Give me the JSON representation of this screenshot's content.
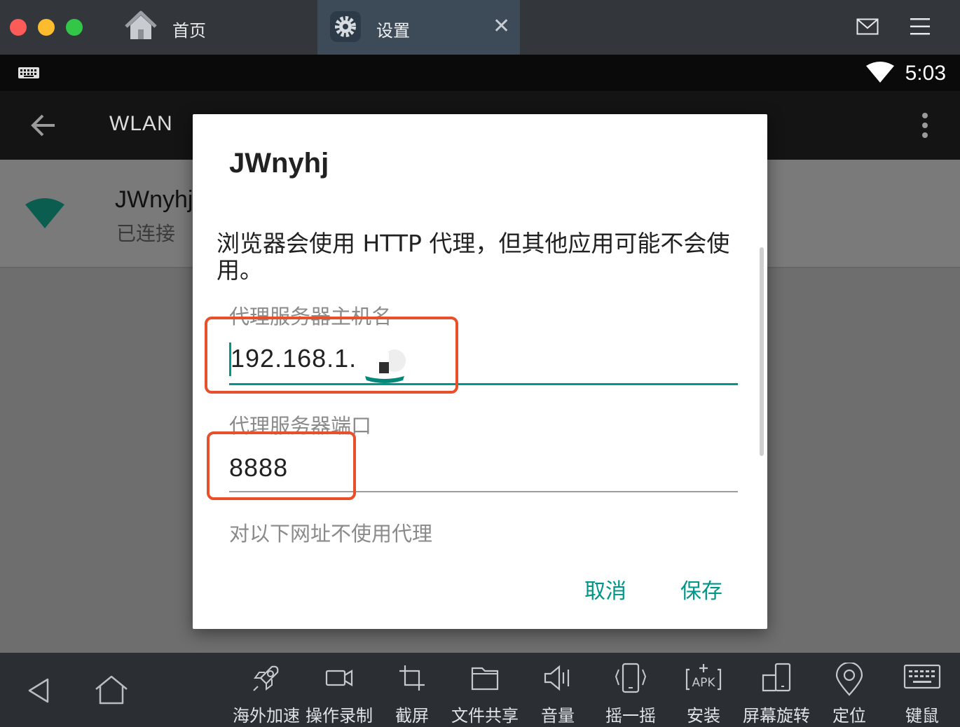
{
  "titlebar": {
    "tabs": [
      {
        "label": "首页",
        "icon": "home-icon"
      },
      {
        "label": "设置",
        "icon": "gear-icon",
        "close": "✕"
      }
    ],
    "traffic_colors": [
      "#fc5b57",
      "#fcbc2e",
      "#33c748"
    ]
  },
  "statusbar": {
    "time": "5:03",
    "icons": [
      "keyboard-icon",
      "wifi-icon"
    ]
  },
  "appbar": {
    "title": "WLAN",
    "icons": [
      "back-arrow-icon",
      "overflow-menu-icon"
    ]
  },
  "network": {
    "name": "JWnyhj",
    "status": "已连接",
    "icon": "wifi-signal-icon"
  },
  "dialog": {
    "title": "JWnyhj",
    "message": "浏览器会使用 HTTP 代理，但其他应用可能不会使用。",
    "hostname_label": "代理服务器主机名",
    "hostname_value": "192.168.1.",
    "port_label": "代理服务器端口",
    "port_value": "8888",
    "bypass_label": "对以下网址不使用代理",
    "cancel": "取消",
    "save": "保存",
    "accent_color": "#009688",
    "annotation_color": "#e8502c"
  },
  "toolbar": {
    "nav": [
      "back-icon",
      "home-icon"
    ],
    "items": [
      {
        "label": "海外加速",
        "icon": "rocket-icon"
      },
      {
        "label": "操作录制",
        "icon": "video-record-icon"
      },
      {
        "label": "截屏",
        "icon": "crop-icon"
      },
      {
        "label": "文件共享",
        "icon": "folder-icon"
      },
      {
        "label": "音量",
        "icon": "volume-icon"
      },
      {
        "label": "摇一摇",
        "icon": "shake-icon"
      },
      {
        "label": "安装",
        "icon": "apk-install-icon"
      },
      {
        "label": "屏幕旋转",
        "icon": "rotate-screen-icon"
      },
      {
        "label": "定位",
        "icon": "location-icon"
      },
      {
        "label": "键鼠",
        "icon": "keyboard-mouse-icon"
      }
    ]
  }
}
